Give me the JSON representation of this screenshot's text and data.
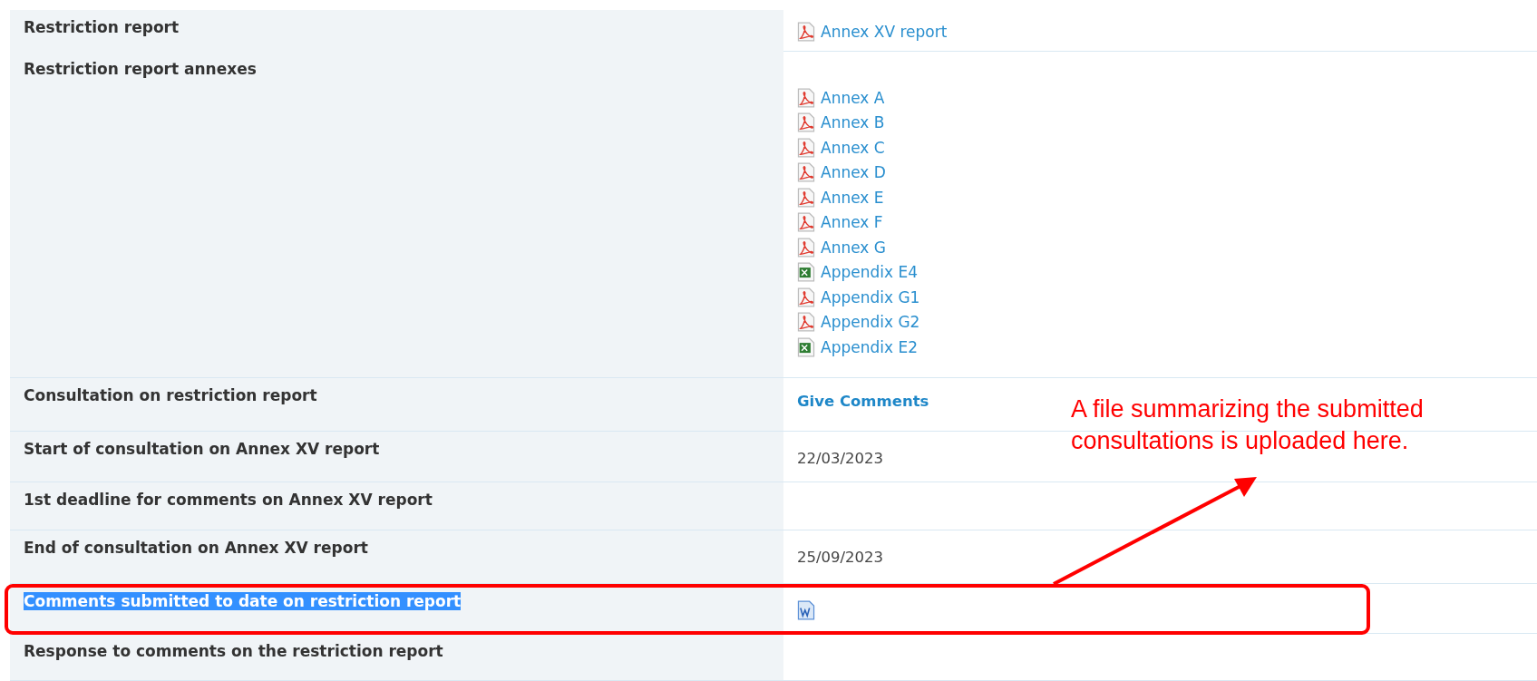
{
  "rows": [
    {
      "label": "Restriction report",
      "highlighted": false,
      "value": {
        "kind": "files",
        "items": [
          {
            "label": "Annex XV report",
            "kind": "pdf"
          }
        ]
      }
    },
    {
      "label": "Restriction report annexes",
      "highlighted": false,
      "value": {
        "kind": "files",
        "leading_blank": true,
        "items": [
          {
            "label": "Annex A",
            "kind": "pdf"
          },
          {
            "label": "Annex B",
            "kind": "pdf"
          },
          {
            "label": "Annex C",
            "kind": "pdf"
          },
          {
            "label": "Annex D",
            "kind": "pdf"
          },
          {
            "label": "Annex E",
            "kind": "pdf"
          },
          {
            "label": "Annex F",
            "kind": "pdf"
          },
          {
            "label": "Annex G",
            "kind": "pdf"
          },
          {
            "label": "Appendix E4",
            "kind": "spreadsheet"
          },
          {
            "label": "Appendix G1",
            "kind": "pdf"
          },
          {
            "label": "Appendix G2",
            "kind": "pdf"
          },
          {
            "label": "Appendix E2",
            "kind": "spreadsheet"
          }
        ]
      }
    },
    {
      "label": "Consultation on restriction report",
      "highlighted": false,
      "value": {
        "kind": "action",
        "text": "Give Comments"
      }
    },
    {
      "label": "Start of consultation on Annex XV report",
      "highlighted": false,
      "value": {
        "kind": "date",
        "text": "22/03/2023"
      }
    },
    {
      "label": "1st deadline for comments on Annex XV report",
      "highlighted": false,
      "value": {
        "kind": "empty"
      }
    },
    {
      "label": "End of consultation on Annex XV report",
      "highlighted": false,
      "value": {
        "kind": "date",
        "text": "25/09/2023"
      }
    },
    {
      "label": "Comments submitted to date on restriction report",
      "highlighted": true,
      "value": {
        "kind": "document"
      }
    },
    {
      "label": "Response to comments on the restriction report",
      "highlighted": false,
      "value": {
        "kind": "empty"
      }
    }
  ],
  "annotation": {
    "text": "A file summarizing the submitted consultations is uploaded here."
  }
}
